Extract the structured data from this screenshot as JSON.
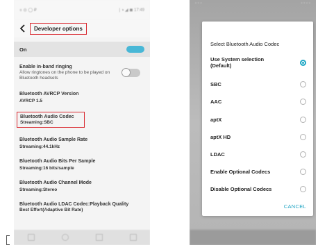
{
  "left": {
    "status_left": "৪ ◎ ◯ ₽",
    "status_right": "| ◑ ◢ ◼ 17:49",
    "title": "Developer options",
    "on_label": "On",
    "inband": {
      "title": "Enable in-band ringing",
      "subtitle": "Allow ringtones on the phone to be played on Bluetooth headsets"
    },
    "settings": [
      {
        "title": "Bluetooth AVRCP Version",
        "value": "AVRCP 1.5"
      },
      {
        "title": "Bluetooth Audio Codec",
        "value": "Streaming:SBC"
      },
      {
        "title": "Bluetooth Audio Sample Rate",
        "value": "Streaming:44.1kHz"
      },
      {
        "title": "Bluetooth Audio Bits Per Sample",
        "value": "Streaming:16 bits/sample"
      },
      {
        "title": "Bluetooth Audio Channel Mode",
        "value": "Streaming:Stereo"
      },
      {
        "title": "Bluetooth Audio LDAC Codec:Playback Quality",
        "value": "Best Effort(Adaptive Bit Rate)"
      }
    ],
    "colors": {
      "highlight": "#d9282f",
      "toggle_on": "#48b7d6"
    }
  },
  "right": {
    "status_left": "◦ ◦ ◦",
    "status_right": "◦ ◦ ◦ ◦",
    "dialog_title": "Select Bluetooth Audio Codec",
    "options": [
      {
        "label": "Use System selection (Default)",
        "selected": true
      },
      {
        "label": "SBC",
        "selected": false
      },
      {
        "label": "AAC",
        "selected": false
      },
      {
        "label": "aptX",
        "selected": false
      },
      {
        "label": "aptX HD",
        "selected": false
      },
      {
        "label": "LDAC",
        "selected": false
      },
      {
        "label": "Enable Optional Codecs",
        "selected": false
      },
      {
        "label": "Disable Optional Codecs",
        "selected": false
      }
    ],
    "cancel_label": "CANCEL",
    "colors": {
      "accent": "#1da7c5"
    }
  }
}
